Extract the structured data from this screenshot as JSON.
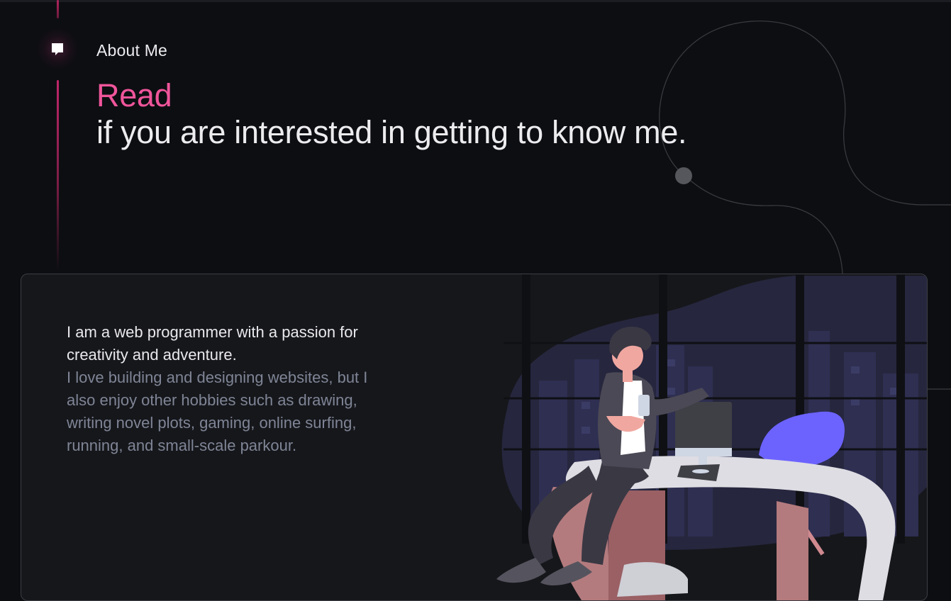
{
  "section": {
    "icon": "chat-bubble-icon",
    "label": "About Me"
  },
  "headline": {
    "accent": "Read",
    "rest": "if you are interested in getting to know me."
  },
  "bio": {
    "intro": "I am a web programmer with a passion for creativity and adventure.",
    "details": "I love building and designing websites, but I also enjoy other hobbies such as drawing, writing novel plots, gaming, online surfing, running, and small-scale parkour."
  },
  "colors": {
    "background": "#0d0e12",
    "accent": "#f0559b",
    "card": "#16171b",
    "muted_text": "#7f8596",
    "illustration_purple": "#6c63ff"
  },
  "illustration": {
    "icon": "developer-at-desk-illustration"
  }
}
